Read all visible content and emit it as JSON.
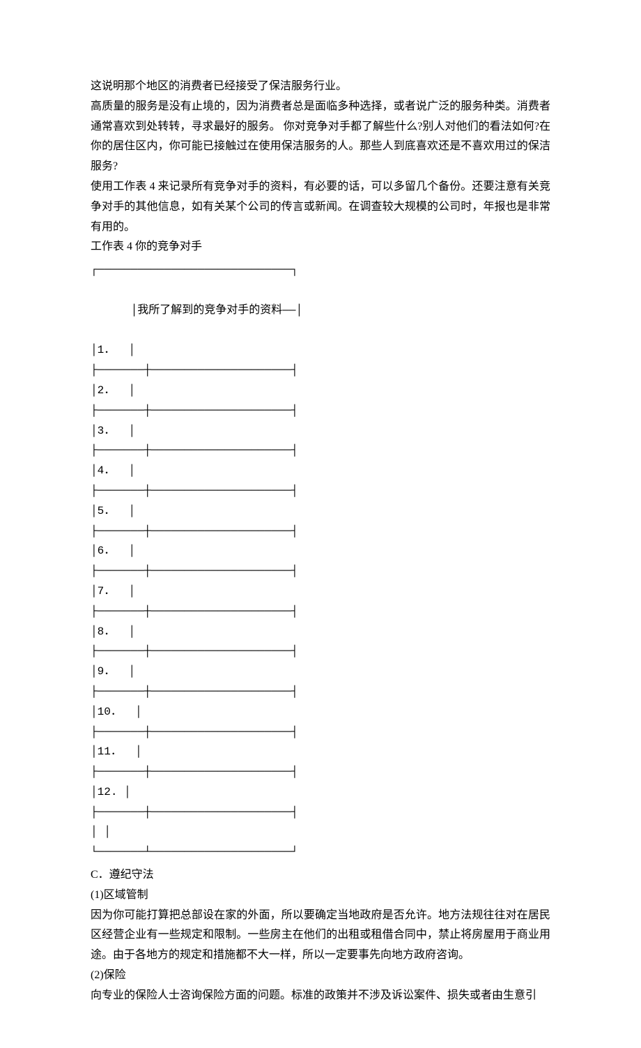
{
  "intro": {
    "line1": "这说明那个地区的消费者已经接受了保洁服务行业。",
    "line2": "高质量的服务是没有止境的，因为消费者总是面临多种选择，或者说广泛的服务种类。消费者通常喜欢到处转转，寻求最好的服务。  你对竞争对手都了解些什么?别人对他们的看法如何?在你的居住区内，你可能已接触过在使用保洁服务的人。那些人到底喜欢还是不喜欢用过的保洁服务?",
    "line3": "使用工作表 4 来记录所有竞争对手的资料，有必要的话，可以多留几个备份。还要注意有关竞争对手的其他信息，如有关某个公司的传言或新闻。在调查较大规模的公司时，年报也是非常有用的。"
  },
  "worksheet": {
    "title": "工作表 4 你的竞争对手",
    "header": "我所了解到的竞争对手的资料——",
    "rows": [
      "1．",
      "2．",
      "3．",
      "4．",
      "5．",
      "6．",
      "7．",
      "8．",
      "9．",
      "10．",
      "11．",
      "12.",
      ""
    ]
  },
  "sectionC": {
    "heading": "C．遵纪守法",
    "sub1": "(1)区域管制",
    "para1": "因为你可能打算把总部设在家的外面，所以要确定当地政府是否允许。地方法规往往对在居民区经营企业有一些规定和限制。一些房主在他们的出租或租借合同中，禁止将房屋用于商业用途。由于各地方的规定和措施都不大一样，所以一定要事先向地方政府咨询。",
    "sub2": "(2)保险",
    "para2": "向专业的保险人士咨询保险方面的问题。标准的政策并不涉及诉讼案件、损失或者由生意引"
  },
  "table_glyphs": {
    "top": "┌─────────────────────────────┐",
    "header_open": "│",
    "header_close": "│",
    "sep": "├───────┼─────────────────────┤",
    "bottom": "└───────┴─────────────────────┘",
    "row_open": "│",
    "row_mid": "│",
    "row_close": "│"
  }
}
